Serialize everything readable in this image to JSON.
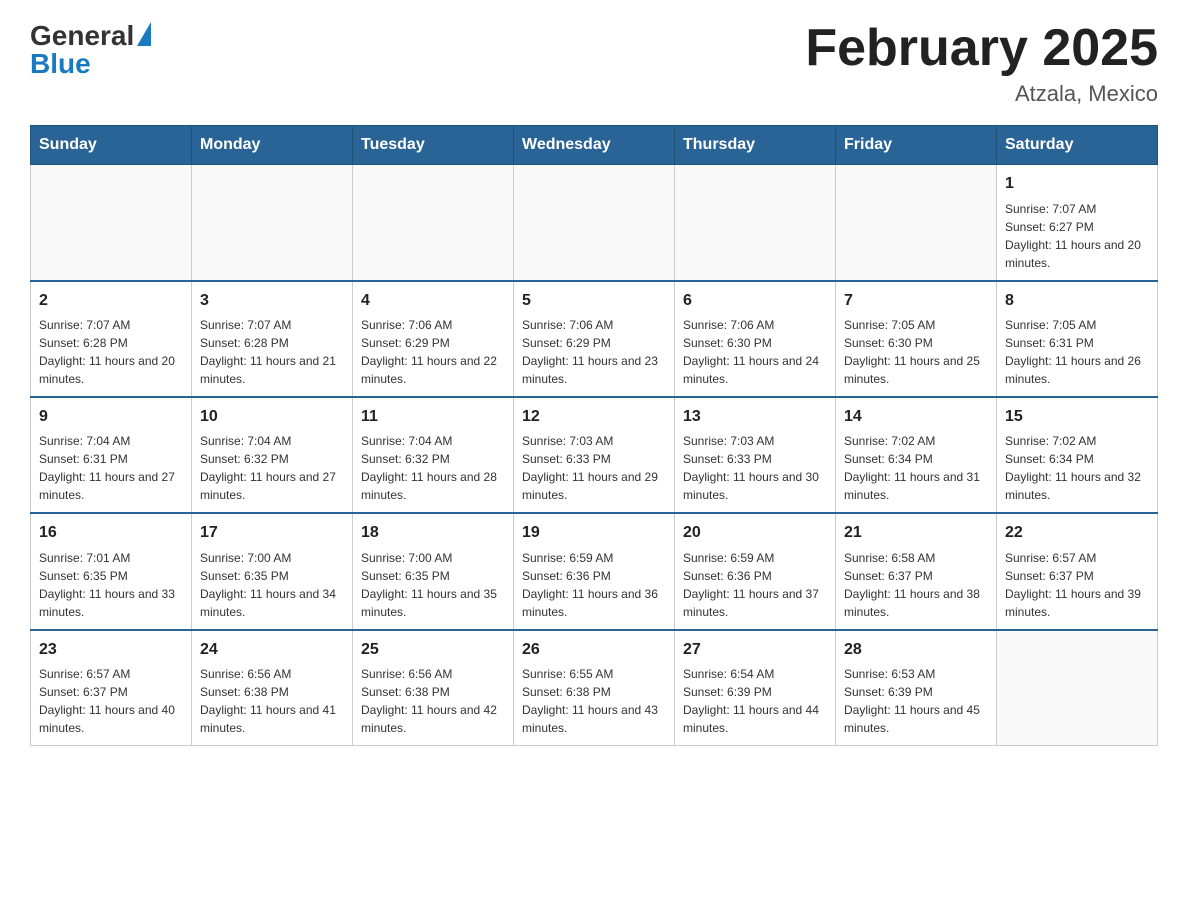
{
  "header": {
    "logo_general": "General",
    "logo_blue": "Blue",
    "month_title": "February 2025",
    "location": "Atzala, Mexico"
  },
  "days_of_week": [
    "Sunday",
    "Monday",
    "Tuesday",
    "Wednesday",
    "Thursday",
    "Friday",
    "Saturday"
  ],
  "weeks": [
    [
      {
        "day": "",
        "info": ""
      },
      {
        "day": "",
        "info": ""
      },
      {
        "day": "",
        "info": ""
      },
      {
        "day": "",
        "info": ""
      },
      {
        "day": "",
        "info": ""
      },
      {
        "day": "",
        "info": ""
      },
      {
        "day": "1",
        "info": "Sunrise: 7:07 AM\nSunset: 6:27 PM\nDaylight: 11 hours and 20 minutes."
      }
    ],
    [
      {
        "day": "2",
        "info": "Sunrise: 7:07 AM\nSunset: 6:28 PM\nDaylight: 11 hours and 20 minutes."
      },
      {
        "day": "3",
        "info": "Sunrise: 7:07 AM\nSunset: 6:28 PM\nDaylight: 11 hours and 21 minutes."
      },
      {
        "day": "4",
        "info": "Sunrise: 7:06 AM\nSunset: 6:29 PM\nDaylight: 11 hours and 22 minutes."
      },
      {
        "day": "5",
        "info": "Sunrise: 7:06 AM\nSunset: 6:29 PM\nDaylight: 11 hours and 23 minutes."
      },
      {
        "day": "6",
        "info": "Sunrise: 7:06 AM\nSunset: 6:30 PM\nDaylight: 11 hours and 24 minutes."
      },
      {
        "day": "7",
        "info": "Sunrise: 7:05 AM\nSunset: 6:30 PM\nDaylight: 11 hours and 25 minutes."
      },
      {
        "day": "8",
        "info": "Sunrise: 7:05 AM\nSunset: 6:31 PM\nDaylight: 11 hours and 26 minutes."
      }
    ],
    [
      {
        "day": "9",
        "info": "Sunrise: 7:04 AM\nSunset: 6:31 PM\nDaylight: 11 hours and 27 minutes."
      },
      {
        "day": "10",
        "info": "Sunrise: 7:04 AM\nSunset: 6:32 PM\nDaylight: 11 hours and 27 minutes."
      },
      {
        "day": "11",
        "info": "Sunrise: 7:04 AM\nSunset: 6:32 PM\nDaylight: 11 hours and 28 minutes."
      },
      {
        "day": "12",
        "info": "Sunrise: 7:03 AM\nSunset: 6:33 PM\nDaylight: 11 hours and 29 minutes."
      },
      {
        "day": "13",
        "info": "Sunrise: 7:03 AM\nSunset: 6:33 PM\nDaylight: 11 hours and 30 minutes."
      },
      {
        "day": "14",
        "info": "Sunrise: 7:02 AM\nSunset: 6:34 PM\nDaylight: 11 hours and 31 minutes."
      },
      {
        "day": "15",
        "info": "Sunrise: 7:02 AM\nSunset: 6:34 PM\nDaylight: 11 hours and 32 minutes."
      }
    ],
    [
      {
        "day": "16",
        "info": "Sunrise: 7:01 AM\nSunset: 6:35 PM\nDaylight: 11 hours and 33 minutes."
      },
      {
        "day": "17",
        "info": "Sunrise: 7:00 AM\nSunset: 6:35 PM\nDaylight: 11 hours and 34 minutes."
      },
      {
        "day": "18",
        "info": "Sunrise: 7:00 AM\nSunset: 6:35 PM\nDaylight: 11 hours and 35 minutes."
      },
      {
        "day": "19",
        "info": "Sunrise: 6:59 AM\nSunset: 6:36 PM\nDaylight: 11 hours and 36 minutes."
      },
      {
        "day": "20",
        "info": "Sunrise: 6:59 AM\nSunset: 6:36 PM\nDaylight: 11 hours and 37 minutes."
      },
      {
        "day": "21",
        "info": "Sunrise: 6:58 AM\nSunset: 6:37 PM\nDaylight: 11 hours and 38 minutes."
      },
      {
        "day": "22",
        "info": "Sunrise: 6:57 AM\nSunset: 6:37 PM\nDaylight: 11 hours and 39 minutes."
      }
    ],
    [
      {
        "day": "23",
        "info": "Sunrise: 6:57 AM\nSunset: 6:37 PM\nDaylight: 11 hours and 40 minutes."
      },
      {
        "day": "24",
        "info": "Sunrise: 6:56 AM\nSunset: 6:38 PM\nDaylight: 11 hours and 41 minutes."
      },
      {
        "day": "25",
        "info": "Sunrise: 6:56 AM\nSunset: 6:38 PM\nDaylight: 11 hours and 42 minutes."
      },
      {
        "day": "26",
        "info": "Sunrise: 6:55 AM\nSunset: 6:38 PM\nDaylight: 11 hours and 43 minutes."
      },
      {
        "day": "27",
        "info": "Sunrise: 6:54 AM\nSunset: 6:39 PM\nDaylight: 11 hours and 44 minutes."
      },
      {
        "day": "28",
        "info": "Sunrise: 6:53 AM\nSunset: 6:39 PM\nDaylight: 11 hours and 45 minutes."
      },
      {
        "day": "",
        "info": ""
      }
    ]
  ]
}
